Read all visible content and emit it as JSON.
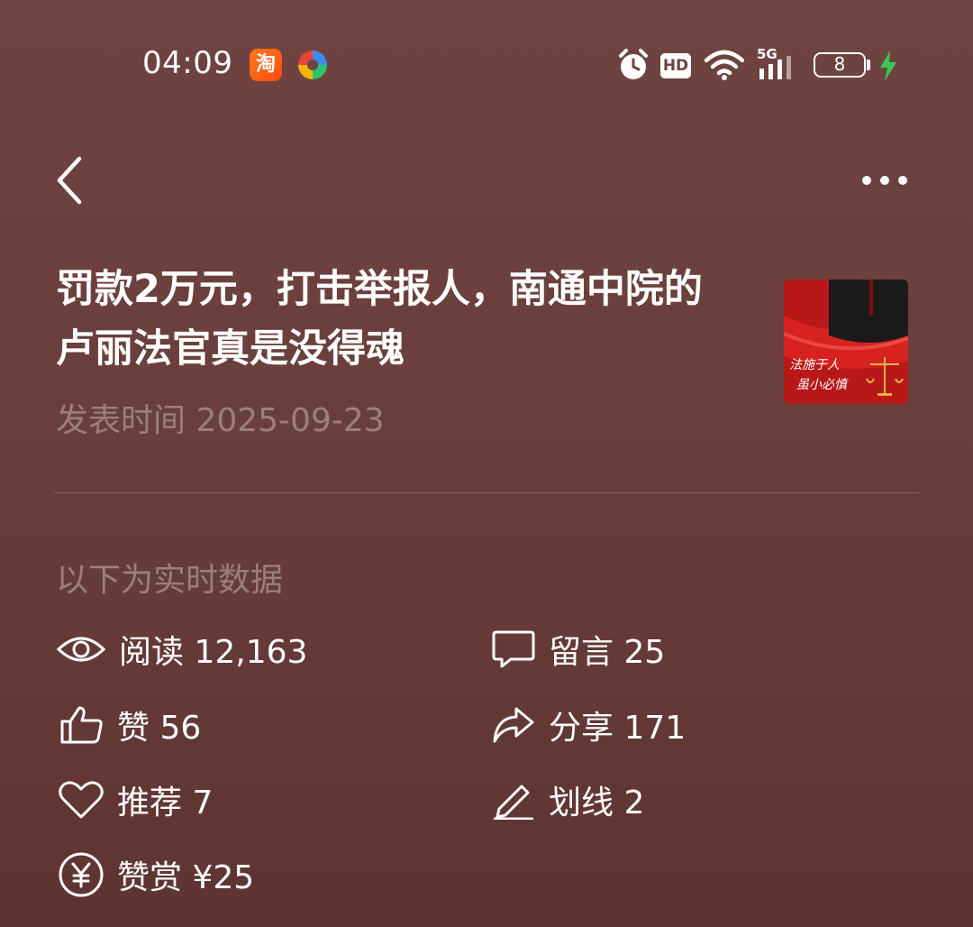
{
  "status_bar": {
    "time": "04:09",
    "taobao_glyph": "淘",
    "hd_label": "HD",
    "network_label": "5G",
    "battery_level": "8",
    "icons": [
      "alarm-icon",
      "wifi-icon",
      "signal-icon",
      "charging-icon"
    ]
  },
  "nav": {
    "back_icon": "chevron-left-icon",
    "more_icon": "more-dots-icon"
  },
  "article": {
    "title": "罚款2万元，打击举报人，南通中院的卢丽法官真是没得魂",
    "date": "发表时间 2025-09-23",
    "cover_text_line1": "法施于人",
    "cover_text_line2": "虽小必慎"
  },
  "realtime_label": "以下为实时数据",
  "stats": {
    "reads": "阅读 12,163",
    "comments": "留言 25",
    "likes": "赞 56",
    "shares": "分享 171",
    "recommends": "推荐 7",
    "underlines": "划线 2",
    "tips": "赞赏 ¥25"
  },
  "colors": {
    "background": "#6a3f3b",
    "muted_text": "#9b7f7b",
    "charging": "#3ec25a"
  }
}
